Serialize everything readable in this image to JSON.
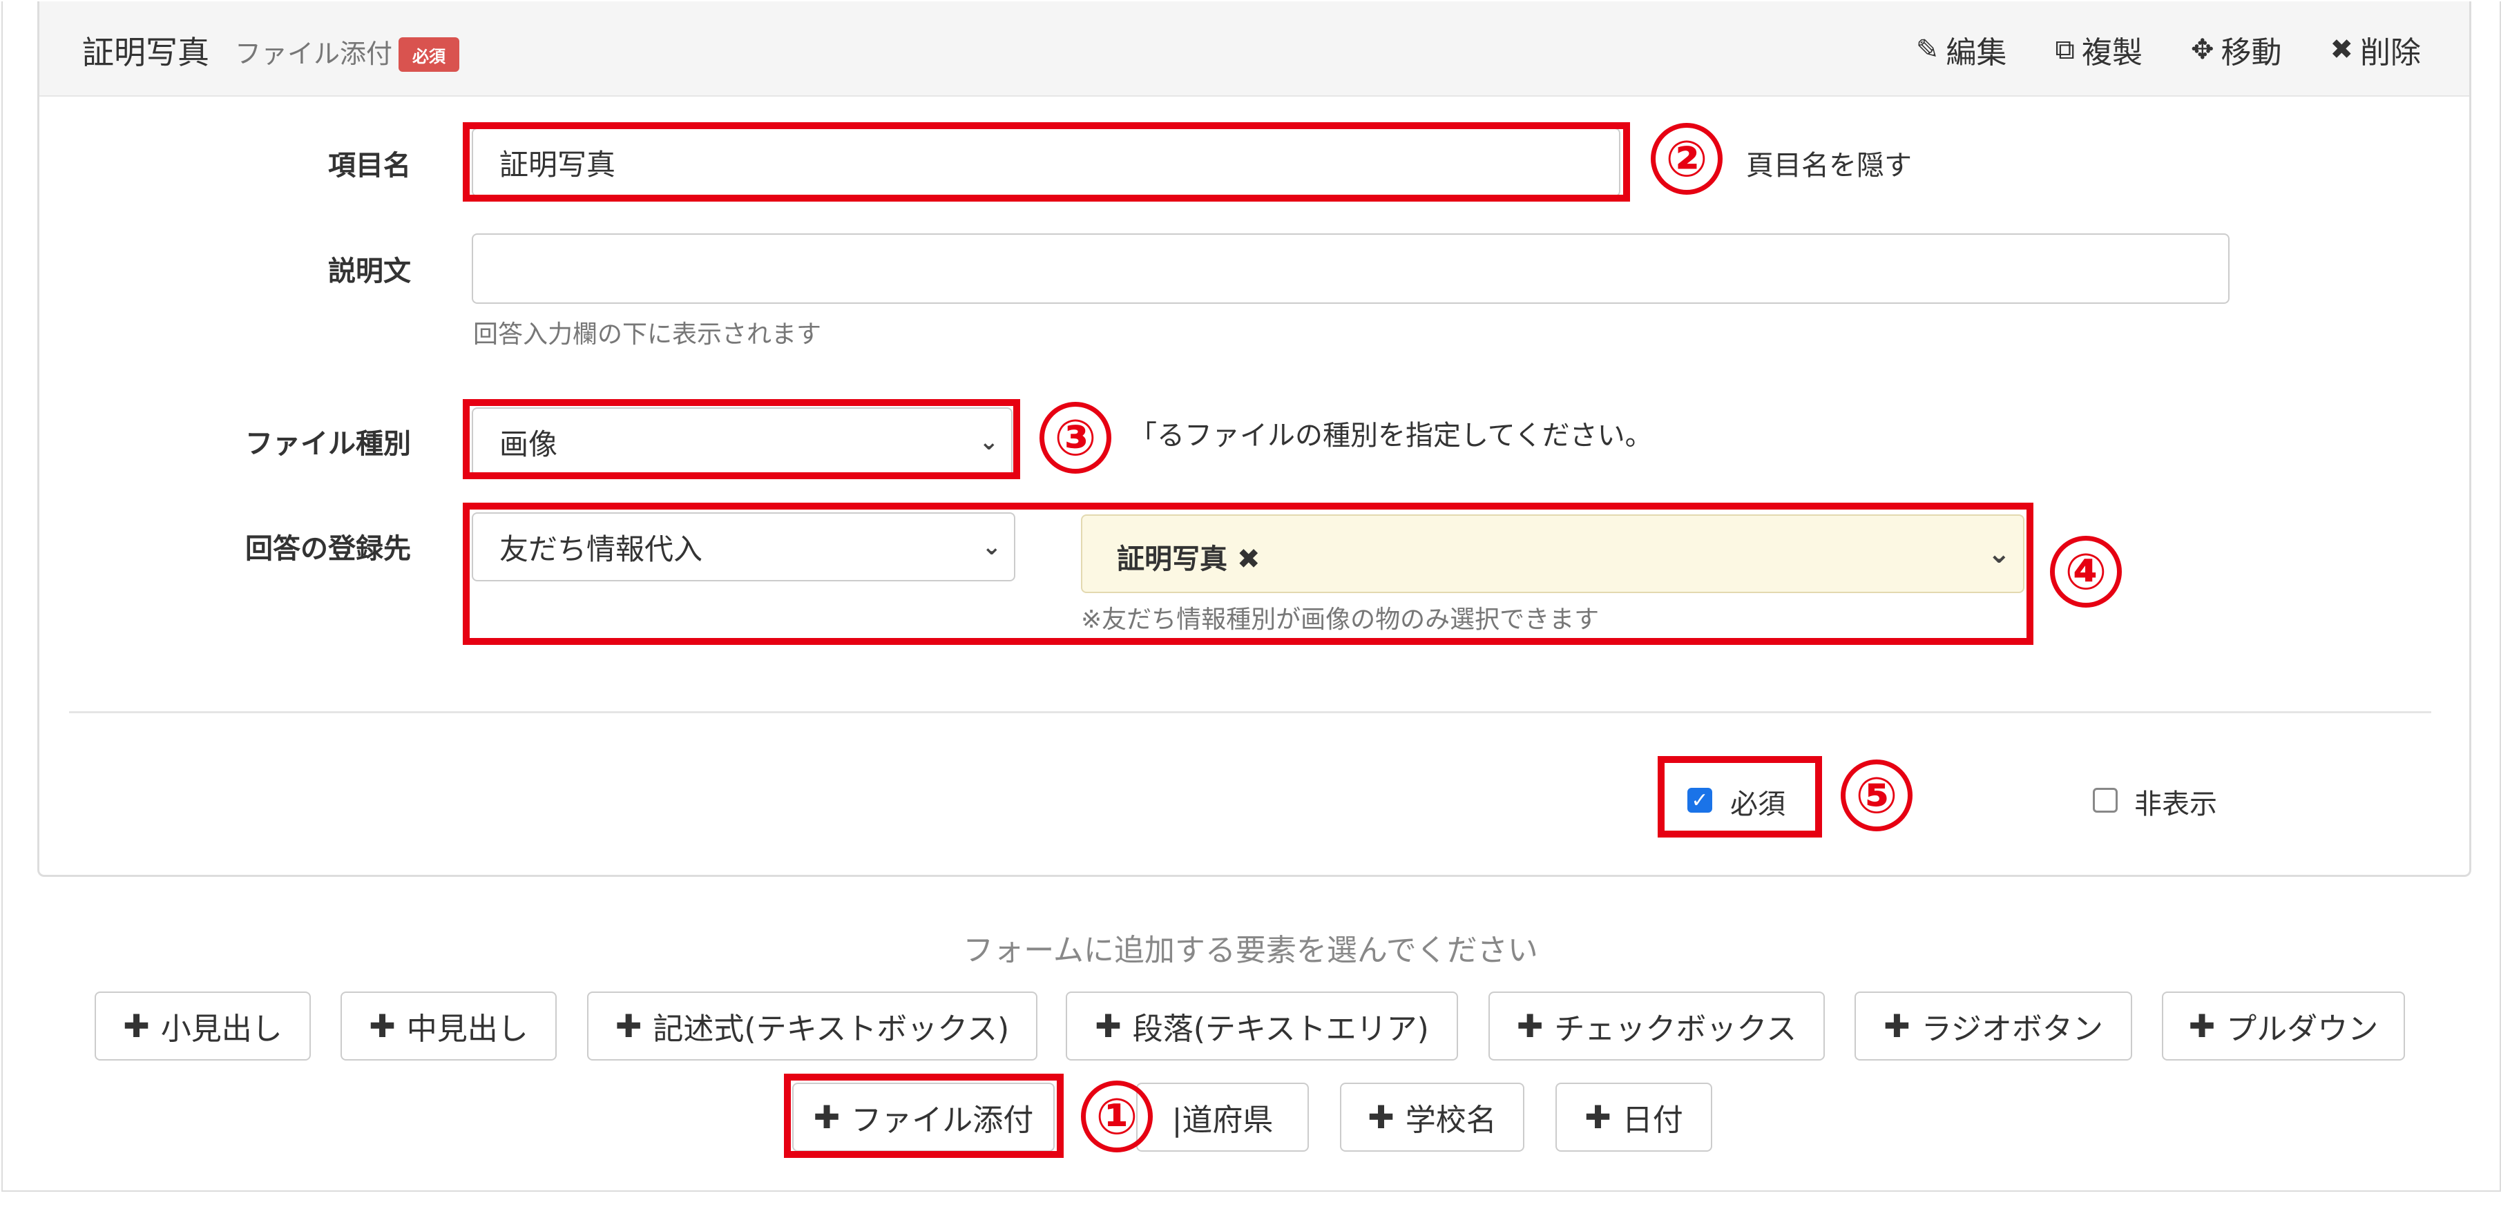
{
  "header": {
    "title": "証明写真",
    "subtitle": "ファイル添付",
    "required_badge": "必須",
    "actions": [
      {
        "icon": "pencil-icon",
        "label": "編集"
      },
      {
        "icon": "copy-icon",
        "label": "複製"
      },
      {
        "icon": "move-icon",
        "label": "移動"
      },
      {
        "icon": "close-icon",
        "label": "削除"
      }
    ]
  },
  "form": {
    "item_name": {
      "label": "項目名",
      "value": "証明写真",
      "hide_label_text": "頁目名を隠す"
    },
    "description": {
      "label": "説明文",
      "value": "",
      "help": "回答入力欄の下に表示されます"
    },
    "file_type": {
      "label": "ファイル種別",
      "value": "画像",
      "help": "「るファイルの種別を指定してください。"
    },
    "destination": {
      "label": "回答の登録先",
      "select_value": "友だち情報代入",
      "tag": "証明写真",
      "note": "※友だち情報種別が画像の物のみ選択できます"
    },
    "required": {
      "label": "必須",
      "checked": true
    },
    "hidden": {
      "label": "非表示",
      "checked": false
    }
  },
  "callouts": [
    "①",
    "②",
    "③",
    "④",
    "⑤"
  ],
  "add_elements": {
    "prompt": "フォームに追加する要素を選んでください",
    "buttons": [
      "小見出し",
      "中見出し",
      "記述式(テキストボックス)",
      "段落(テキストエリア)",
      "チェックボックス",
      "ラジオボタン",
      "プルダウン",
      "ファイル添付",
      "都道府県",
      "学校名",
      "日付"
    ],
    "partial_label": "|道府県"
  },
  "colors": {
    "callout_red": "#e60012",
    "badge_red": "#d9534f",
    "tag_bg": "#fcf8e3",
    "checkbox_blue": "#1a73e8"
  }
}
